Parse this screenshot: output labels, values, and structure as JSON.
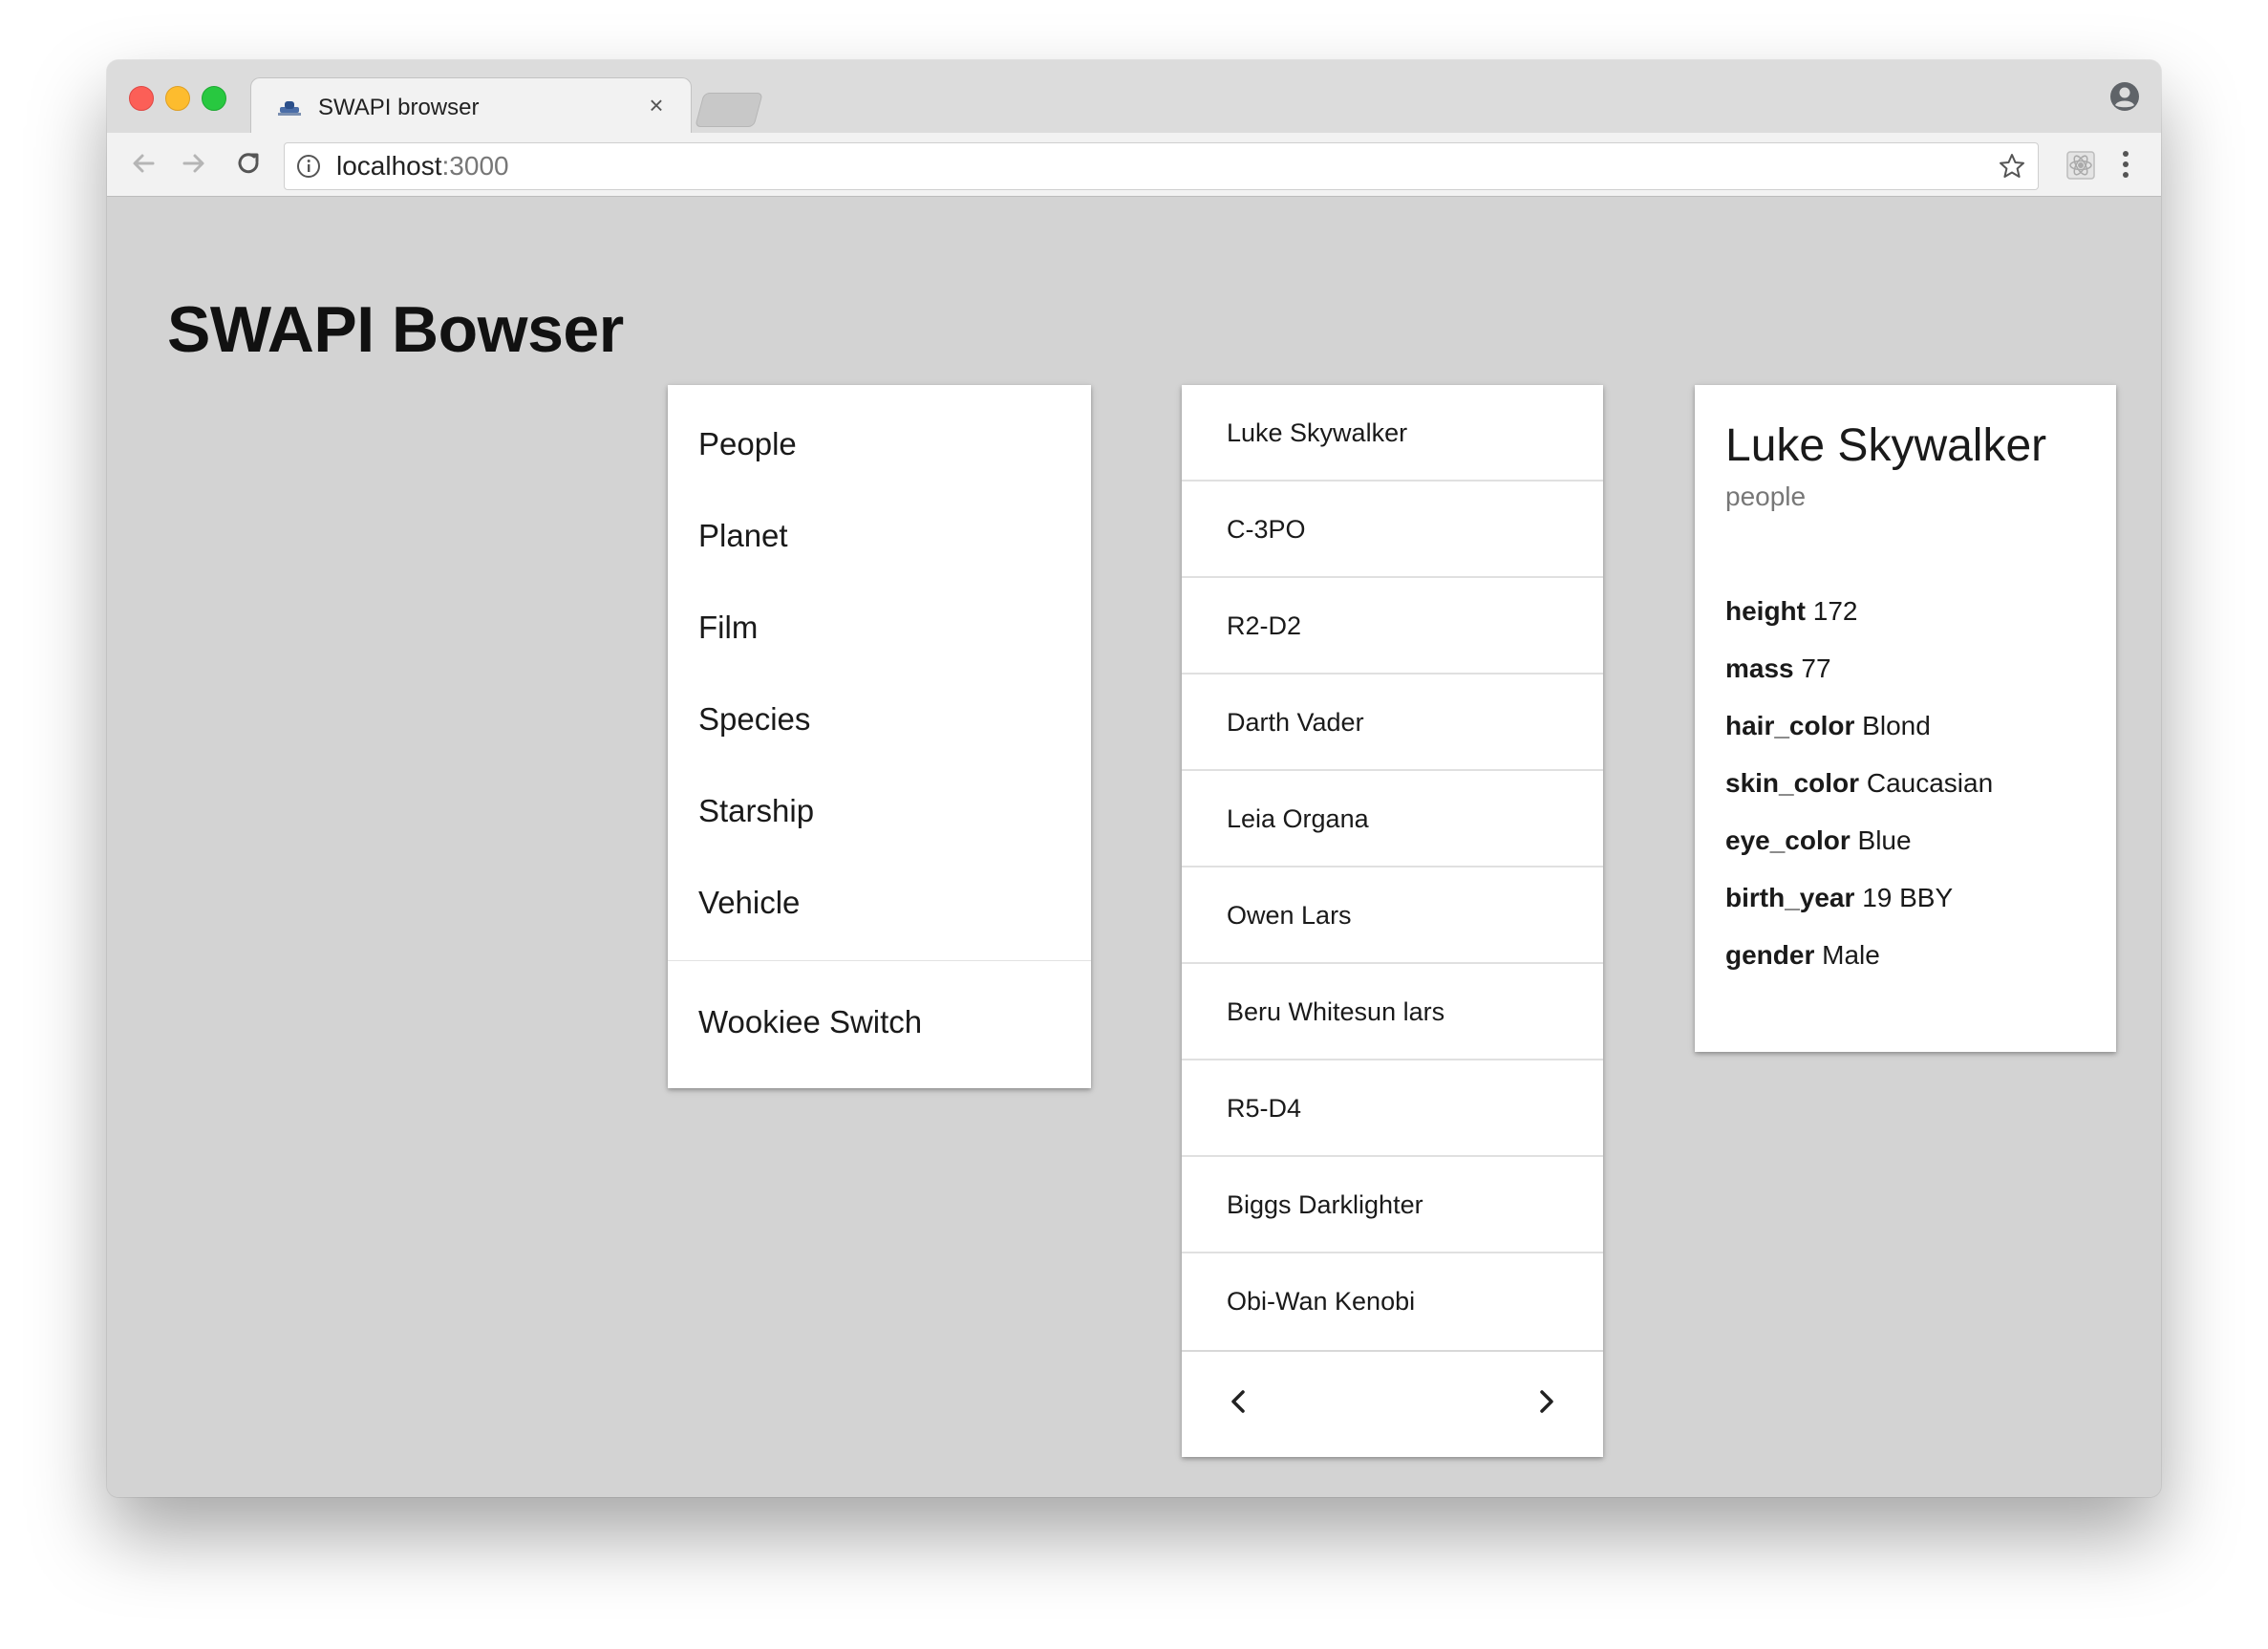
{
  "browser": {
    "tab_title": "SWAPI browser",
    "close_glyph": "×",
    "url_host": "localhost",
    "url_port": ":3000"
  },
  "page": {
    "title": "SWAPI Bowser"
  },
  "categories": {
    "items": [
      {
        "label": "People"
      },
      {
        "label": "Planet"
      },
      {
        "label": "Film"
      },
      {
        "label": "Species"
      },
      {
        "label": "Starship"
      },
      {
        "label": "Vehicle"
      }
    ],
    "switch_label": "Wookiee Switch"
  },
  "results": {
    "items": [
      {
        "name": "Luke Skywalker"
      },
      {
        "name": "C-3PO"
      },
      {
        "name": "R2-D2"
      },
      {
        "name": "Darth Vader"
      },
      {
        "name": "Leia Organa"
      },
      {
        "name": "Owen Lars"
      },
      {
        "name": "Beru Whitesun lars"
      },
      {
        "name": "R5-D4"
      },
      {
        "name": "Biggs Darklighter"
      },
      {
        "name": "Obi-Wan Kenobi"
      }
    ]
  },
  "detail": {
    "name": "Luke Skywalker",
    "type": "people",
    "attributes": [
      {
        "key": "height",
        "value": "172"
      },
      {
        "key": "mass",
        "value": "77"
      },
      {
        "key": "hair_color",
        "value": "Blond"
      },
      {
        "key": "skin_color",
        "value": "Caucasian"
      },
      {
        "key": "eye_color",
        "value": "Blue"
      },
      {
        "key": "birth_year",
        "value": "19 BBY"
      },
      {
        "key": "gender",
        "value": "Male"
      }
    ]
  },
  "icons": {
    "close": "close-icon",
    "back": "arrow-left-icon",
    "forward": "arrow-right-icon",
    "reload": "reload-icon",
    "info": "info-icon",
    "star": "star-icon",
    "profile": "profile-icon",
    "extension": "extension-icon",
    "menu": "kebab-menu-icon",
    "prev": "chevron-left-icon",
    "next": "chevron-right-icon"
  }
}
